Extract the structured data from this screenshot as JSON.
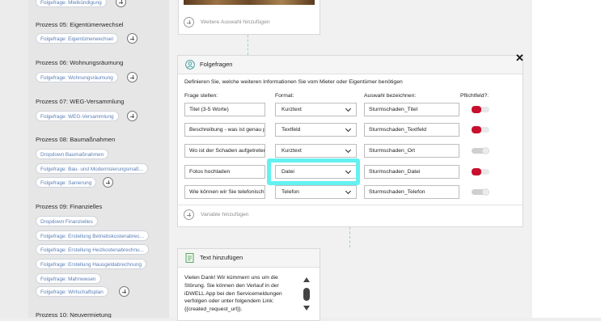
{
  "sidebar": {
    "top_chip": "Folgefrage: Mietkündigung",
    "processes": [
      {
        "title": "Prozess 05: Eigentümerwechsel",
        "chips": [
          "Folgefrage: Eigentümerwechsel"
        ]
      },
      {
        "title": "Prozess 06: Wohnungsräumung",
        "chips": [
          "Folgefrage: Wohnungsräumung"
        ]
      },
      {
        "title": "Prozess 07: WEG-Versammlung",
        "chips": [
          "Folgefrage: WEG-Versammlung"
        ]
      },
      {
        "title": "Prozess 08: Baumaßnahmen",
        "chips": [
          "Dropdown Baumaßnahmen",
          "Folgefrage: Bau- und Modernisierungsmaß...",
          "Folgefrage: Sanierung"
        ]
      },
      {
        "title": "Prozess 09: Finanzielles",
        "chips": [
          "Dropdown Finanzielles",
          "Folgefrage: Erstellung Betriebskostenabrec...",
          "Folgefrage: Erstellung Heizkostenabrechnu...",
          "Folgefrage: Erstellung Hausgeldabrechnung",
          "Folgefrage: Mahnwesen",
          "Folgefrage: Wirtschaftsplan"
        ]
      },
      {
        "title": "Prozess 10: Neuvermietung",
        "chips": []
      }
    ]
  },
  "top_card": {
    "add_label": "Weitere Auswahl hinzufügen"
  },
  "followup": {
    "title": "Folgefragen",
    "description": "Definieren Sie, welche weiteren Informationen Sie vom Mieter oder Eigentümer benötigen",
    "headers": {
      "question": "Frage stellen:",
      "format": "Format:",
      "name": "Auswahl bezeichnen:",
      "required": "Pflichtfeld?:"
    },
    "rows": [
      {
        "question": "Titel (3-5 Worte)",
        "format": "Kurztext",
        "name": "Sturmschaden_Titel",
        "required": true
      },
      {
        "question": "Beschreibung - was ist genau passiert?",
        "format": "Textfeld",
        "name": "Sturmschaden_Textfeld",
        "required": true
      },
      {
        "question": "Wo ist der Schaden aufgetreten?",
        "format": "Kurztext",
        "name": "Sturmschaden_Ort",
        "required": false
      },
      {
        "question": "Fotos hochladen",
        "format": "Datei",
        "name": "Sturmschaden_Datei",
        "required": true
      },
      {
        "question": "Wie können wir Sie telefonisch erreichen?",
        "format": "Telefon",
        "name": "Sturmschaden_Telefon",
        "required": false
      }
    ],
    "add_variable": "Variable hinzufügen",
    "close": "✕"
  },
  "text_card": {
    "title": "Text hinzufügen",
    "message": "Vielen Dank! Wir kümmern uns um die Störung. Sie können den Verlauf in der iDWELL App bei den Servicemeldungen verfolgen oder unter folgendem Link: {{created_request_url}}."
  },
  "icons": {
    "user": "user-icon",
    "document": "document-icon",
    "close": "close-icon",
    "plus": "plus-icon",
    "chevron": "chevron-down-icon"
  },
  "colors": {
    "accent_highlight": "#63f1f1",
    "toggle_on": "#c8102e",
    "chip_text": "#5b7fb6"
  }
}
